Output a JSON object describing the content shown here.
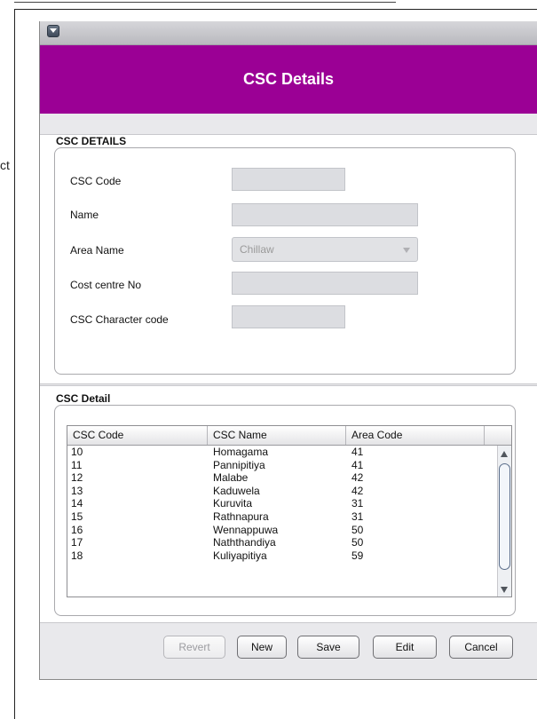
{
  "background": {
    "fragment_text": "ct"
  },
  "window": {
    "title": "CSC Details",
    "accent_color": "#9b0095",
    "control_icon": "dropdown-arrow-icon"
  },
  "details_section": {
    "title": "CSC DETAILS",
    "fields": {
      "csc_code": {
        "label": "CSC Code",
        "value": ""
      },
      "name": {
        "label": "Name",
        "value": ""
      },
      "area_name": {
        "label": "Area Name",
        "value": "Chillaw"
      },
      "cost_centre": {
        "label": "Cost centre No",
        "value": ""
      },
      "char_code": {
        "label": "CSC Character code",
        "value": ""
      }
    }
  },
  "detail_table": {
    "title": "CSC Detail",
    "columns": [
      "CSC Code",
      "CSC Name",
      "Area Code"
    ],
    "rows": [
      [
        "10",
        "Homagama",
        "41"
      ],
      [
        "11",
        "Pannipitiya",
        "41"
      ],
      [
        "12",
        "Malabe",
        "42"
      ],
      [
        "13",
        "Kaduwela",
        "42"
      ],
      [
        "14",
        "Kuruvita",
        "31"
      ],
      [
        "15",
        "Rathnapura",
        "31"
      ],
      [
        "16",
        "Wennappuwa",
        "50"
      ],
      [
        "17",
        "Naththandiya",
        "50"
      ],
      [
        "18",
        "Kuliyapitiya",
        "59"
      ]
    ]
  },
  "buttons": {
    "revert": "Revert",
    "new": "New",
    "save": "Save",
    "edit": "Edit",
    "cancel": "Cancel"
  }
}
